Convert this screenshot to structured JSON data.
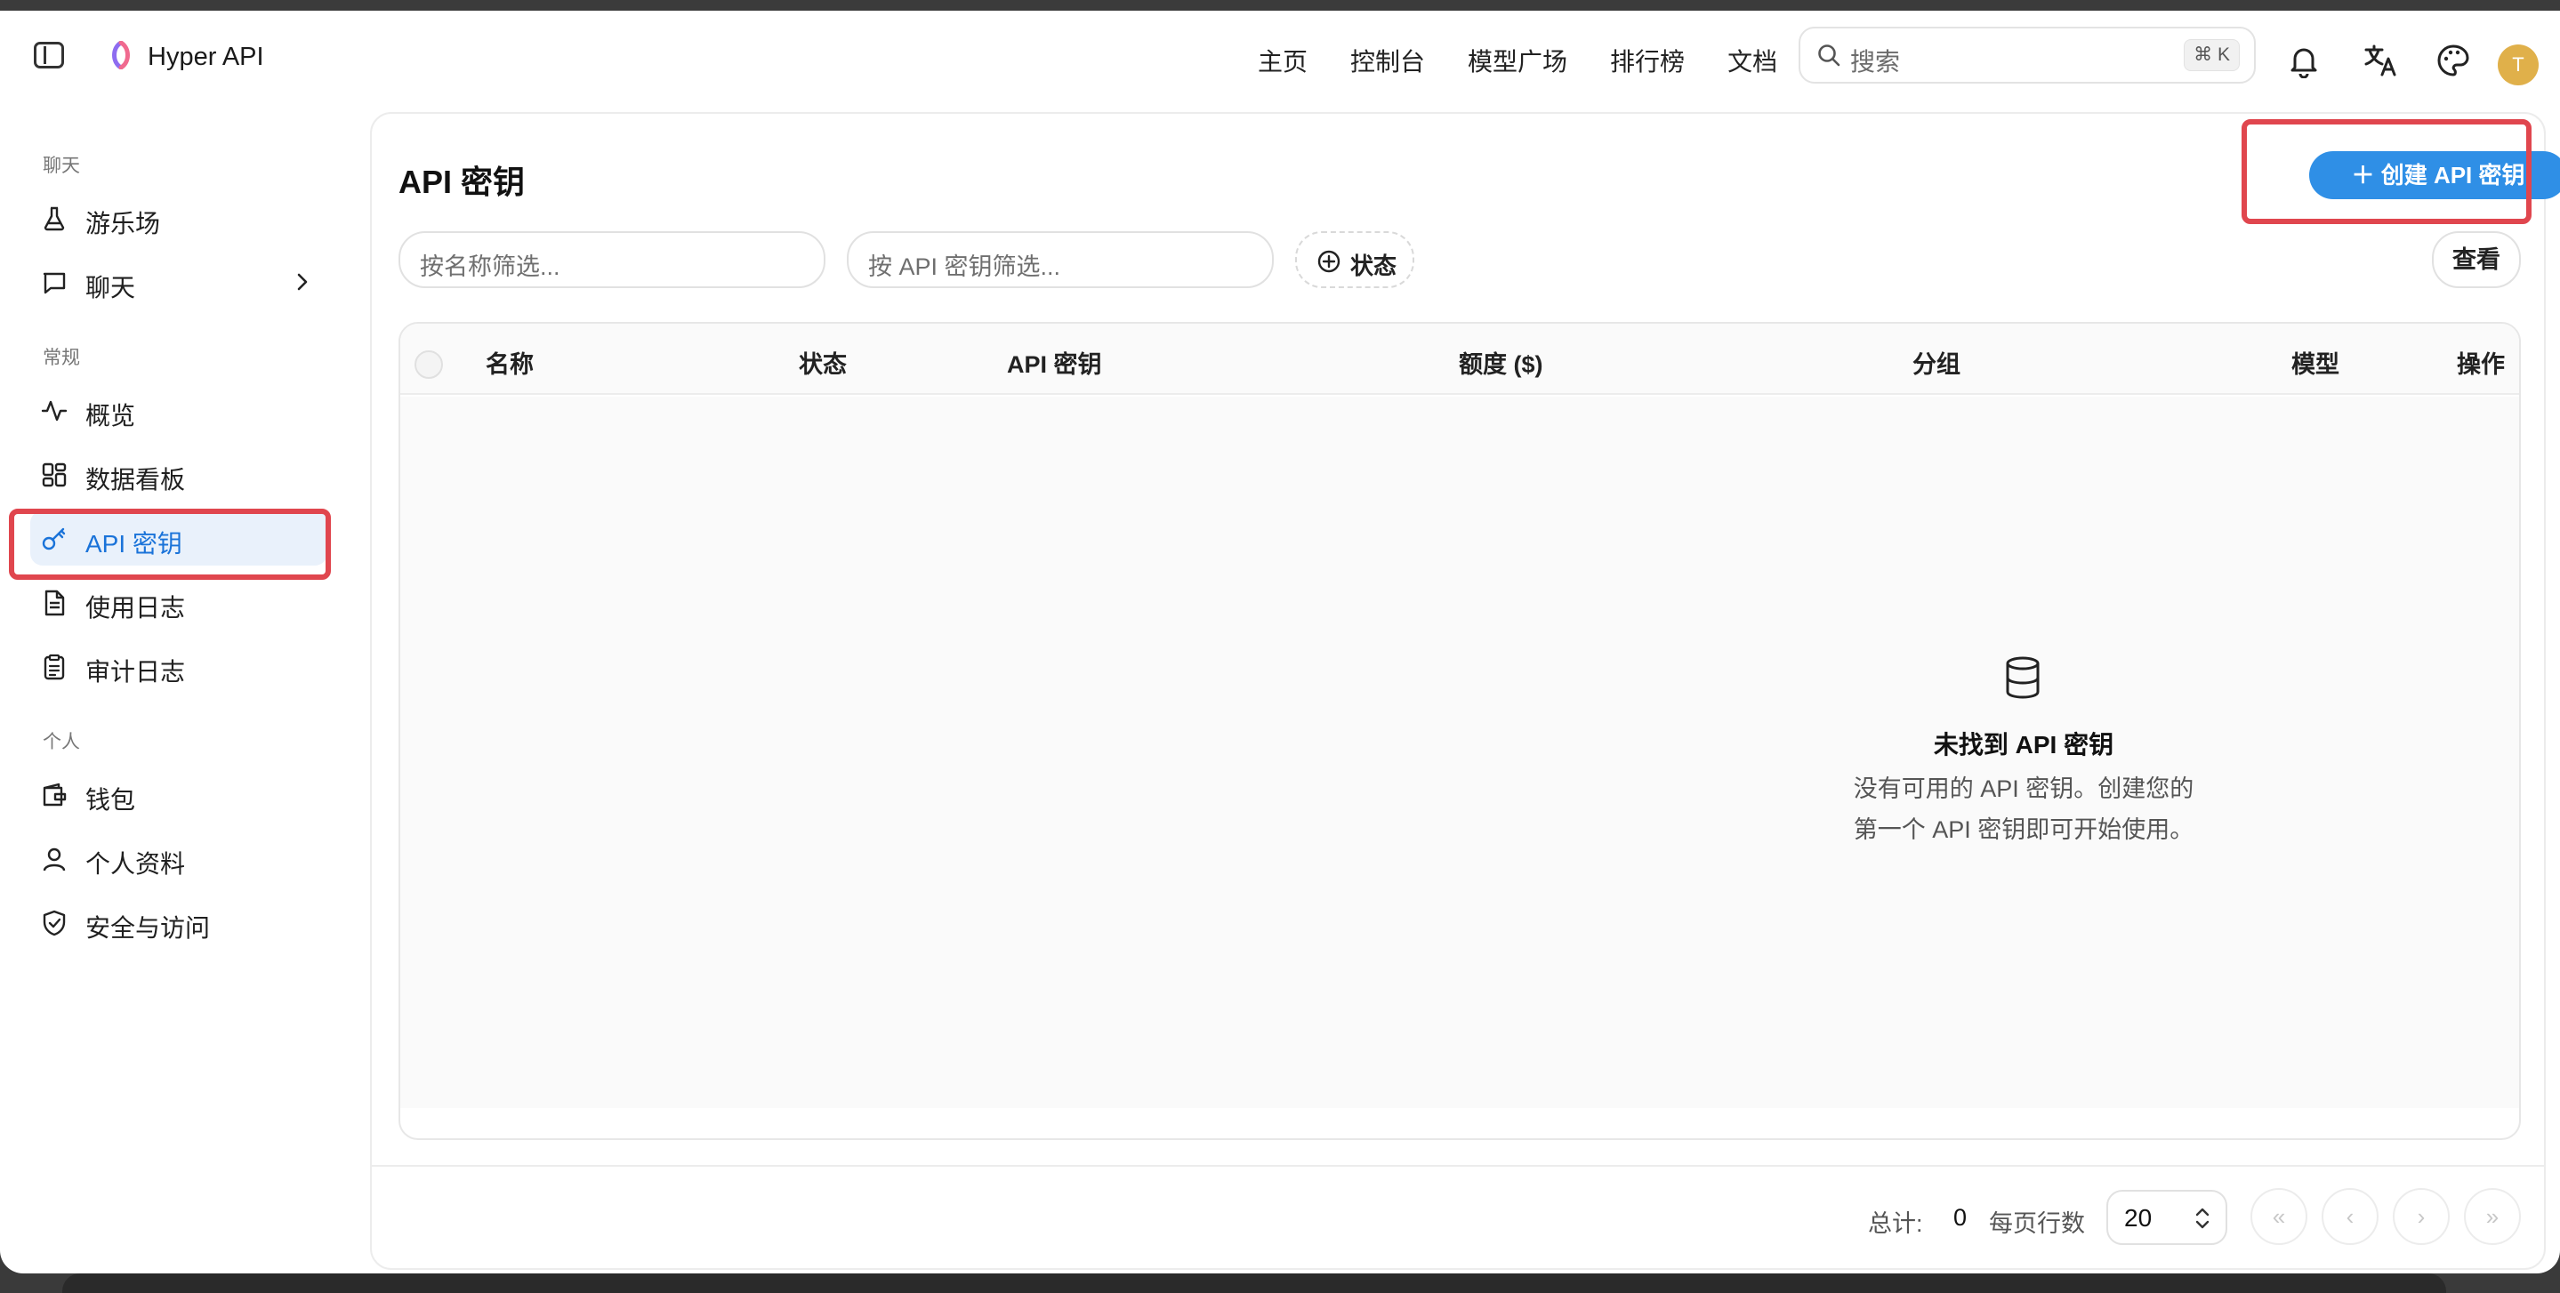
{
  "app": {
    "brand": "Hyper API"
  },
  "topnav": [
    {
      "label": "主页"
    },
    {
      "label": "控制台"
    },
    {
      "label": "模型广场"
    },
    {
      "label": "排行榜"
    },
    {
      "label": "文档"
    }
  ],
  "search": {
    "placeholder": "搜索",
    "shortcut": "⌘ K"
  },
  "user": {
    "avatar_initial": "T"
  },
  "sidebar": {
    "sections": [
      {
        "title": "聊天"
      },
      {
        "title": "常规"
      },
      {
        "title": "个人"
      }
    ],
    "items": [
      {
        "label": "游乐场",
        "icon": "flask-icon"
      },
      {
        "label": "聊天",
        "icon": "message-square-icon"
      },
      {
        "label": "概览",
        "icon": "activity-icon"
      },
      {
        "label": "数据看板",
        "icon": "dashboard-grid-icon"
      },
      {
        "label": "API 密钥",
        "icon": "key-icon",
        "active": true
      },
      {
        "label": "使用日志",
        "icon": "file-text-icon"
      },
      {
        "label": "审计日志",
        "icon": "clipboard-list-icon"
      },
      {
        "label": "钱包",
        "icon": "wallet-icon"
      },
      {
        "label": "个人资料",
        "icon": "user-icon"
      },
      {
        "label": "安全与访问",
        "icon": "shield-check-icon"
      }
    ]
  },
  "page": {
    "title": "API 密钥",
    "create_button": "创建 API 密钥",
    "filter_name_placeholder": "按名称筛选...",
    "filter_key_placeholder": "按 API 密钥筛选...",
    "status_button": "状态",
    "view_button": "查看"
  },
  "table": {
    "columns": [
      "名称",
      "状态",
      "API 密钥",
      "额度 ($)",
      "分组",
      "模型",
      "操作"
    ],
    "rows": [],
    "empty_title": "未找到 API 密钥",
    "empty_desc_line1": "没有可用的 API 密钥。创建您的",
    "empty_desc_line2": "第一个 API 密钥即可开始使用。"
  },
  "pagination": {
    "total_label": "总计:",
    "total_value": "0",
    "rows_per_page_label": "每页行数",
    "rows_per_page": "20",
    "first": "«",
    "prev": "‹",
    "next": "›",
    "last": "»"
  },
  "colors": {
    "accent": "#2f8fe6",
    "active_bg": "#e9f1fb",
    "active_text": "#1a73d9",
    "highlight_box": "#e0464e",
    "avatar": "#e0b04a"
  }
}
